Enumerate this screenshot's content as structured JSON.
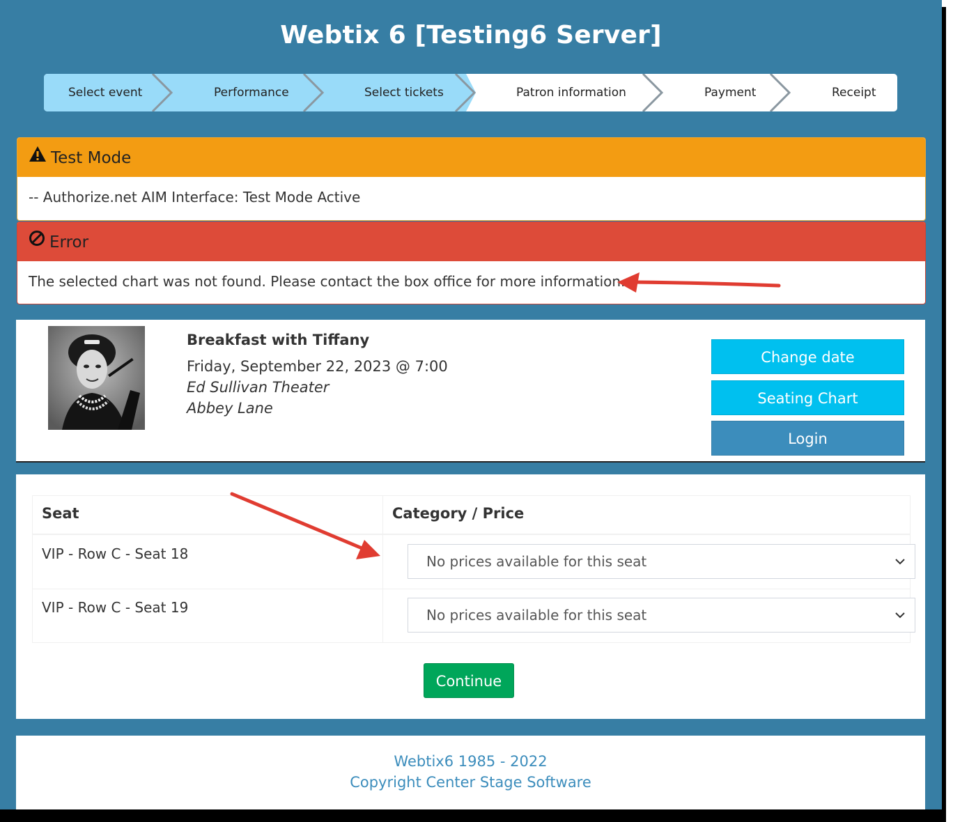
{
  "app": {
    "title": "Webtix 6 [Testing6 Server]"
  },
  "steps": [
    {
      "label": "Select event",
      "state": "done"
    },
    {
      "label": "Performance",
      "state": "done"
    },
    {
      "label": "Select tickets",
      "state": "current"
    },
    {
      "label": "Patron information",
      "state": "todo"
    },
    {
      "label": "Payment",
      "state": "todo"
    },
    {
      "label": "Receipt",
      "state": "todo"
    }
  ],
  "alerts": {
    "test_mode": {
      "title": "Test Mode",
      "message": "-- Authorize.net AIM Interface: Test Mode Active",
      "color": "#f39c12",
      "icon": "warning-icon"
    },
    "error": {
      "title": "Error",
      "message": "The selected chart was not found. Please contact the box office for more information.",
      "color": "#dd4b39",
      "icon": "ban-icon"
    }
  },
  "event": {
    "title": "Breakfast with Tiffany",
    "date": "Friday, September 22, 2023 @ 7:00",
    "venue": "Ed Sullivan Theater",
    "area": "Abbey Lane",
    "image_icon": "event-poster-photo"
  },
  "actions": {
    "change_date": "Change date",
    "seating_chart": "Seating Chart",
    "login": "Login"
  },
  "seats": {
    "headers": {
      "seat": "Seat",
      "category": "Category / Price"
    },
    "rows": [
      {
        "seat": "VIP - Row C - Seat 18",
        "price": "No prices available for this seat"
      },
      {
        "seat": "VIP - Row C - Seat 19",
        "price": "No prices available for this seat"
      }
    ],
    "continue": "Continue"
  },
  "footer": {
    "line1": "Webtix6 1985 - 2022",
    "line2": "Copyright Center Stage Software"
  },
  "colors": {
    "background": "#377ea4",
    "step_done": "#99dbf9",
    "info_button": "#00c0ef",
    "primary_button": "#3c8dbc",
    "success_button": "#00a65a",
    "annotation_arrow": "#e03c31"
  }
}
